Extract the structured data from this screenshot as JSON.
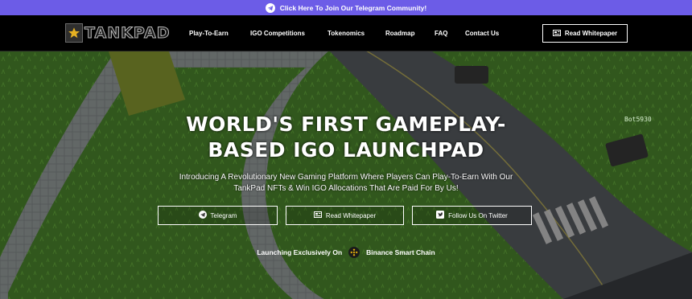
{
  "banner": {
    "text": "Click Here To Join Our Telegram Community!",
    "icon": "telegram-icon"
  },
  "nav": {
    "logo_text": "TANKPAD",
    "items": [
      {
        "label": "Play-To-Earn"
      },
      {
        "label": "IGO Competitions"
      },
      {
        "label": "Tokenomics"
      },
      {
        "label": "Roadmap"
      },
      {
        "label": "FAQ"
      },
      {
        "label": "Contact Us"
      }
    ],
    "whitepaper_label": "Read Whitepaper"
  },
  "hero": {
    "headline_line1": "WORLD'S FIRST GAMEPLAY-",
    "headline_line2": "BASED IGO LAUNCHPAD",
    "sub_line1": "Introducing A Revolutionary New Gaming Platform Where Players Can Play-To-Earn With Our",
    "sub_line2": "TankPad NFTs & Win IGO Allocations That Are Paid For By Us!",
    "buttons": {
      "telegram": "Telegram",
      "whitepaper": "Read Whitepaper",
      "twitter": "Follow Us On Twitter"
    },
    "launch_prefix": "Launching Exclusively On",
    "chain": "Binance Smart Chain",
    "game_tag": "Bot5930"
  },
  "colors": {
    "banner": "#6c5ce7",
    "nav_bg": "#000000",
    "grass": "#4d8a2e",
    "road": "#5d6166"
  }
}
